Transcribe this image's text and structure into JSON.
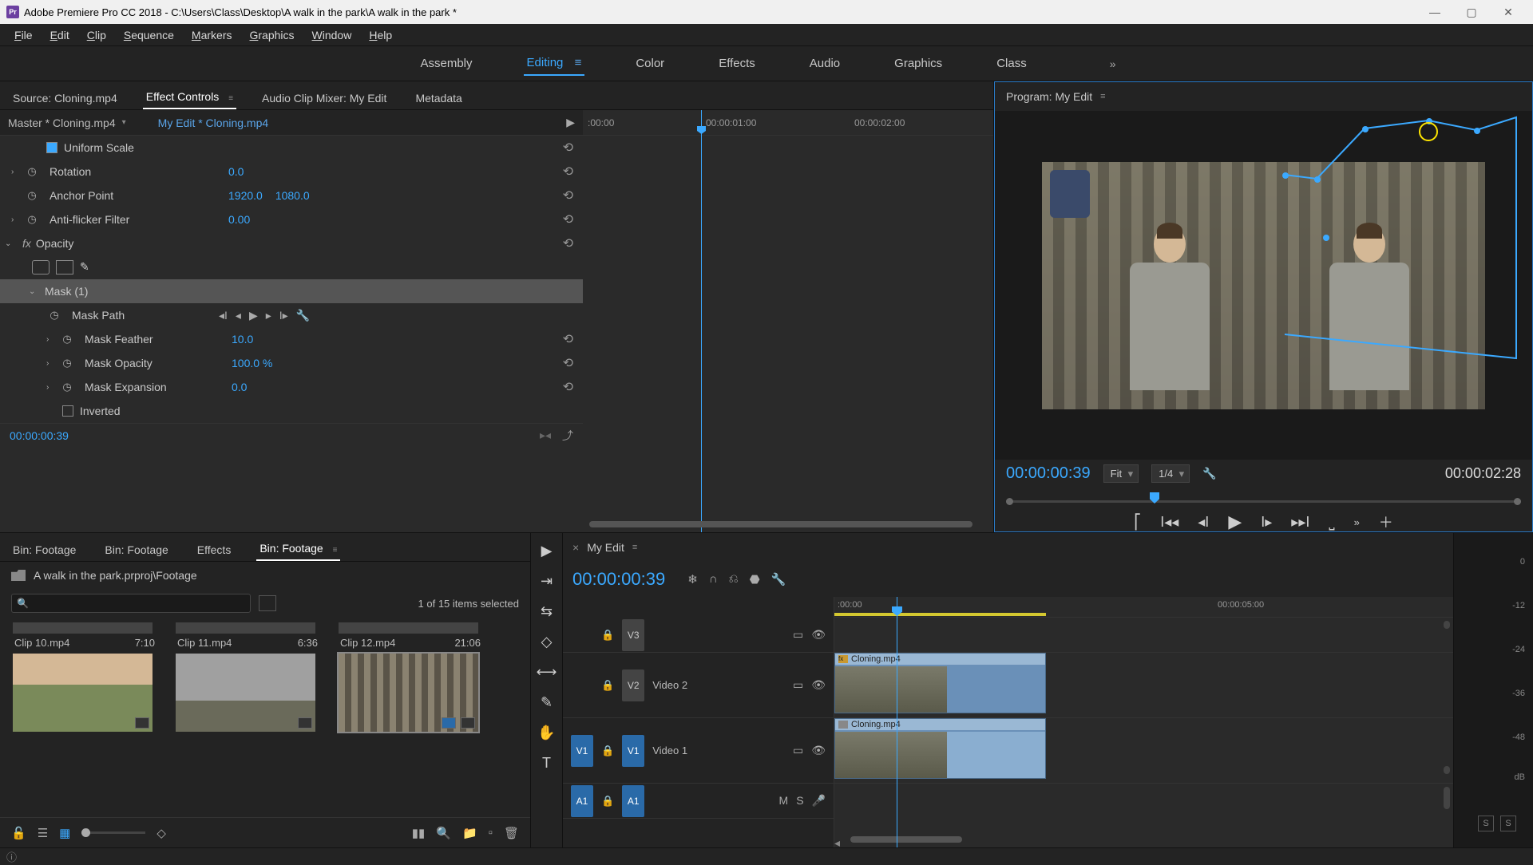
{
  "titlebar": {
    "app_abbrev": "Pr",
    "text": "Adobe Premiere Pro CC 2018 - C:\\Users\\Class\\Desktop\\A walk in the park\\A walk in the park *"
  },
  "menu": {
    "file": "File",
    "edit": "Edit",
    "clip": "Clip",
    "sequence": "Sequence",
    "markers": "Markers",
    "graphics": "Graphics",
    "window": "Window",
    "help": "Help"
  },
  "workspaces": {
    "assembly": "Assembly",
    "editing": "Editing",
    "color": "Color",
    "effects": "Effects",
    "audio": "Audio",
    "graphics": "Graphics",
    "class": "Class"
  },
  "source_tabs": {
    "source": "Source: Cloning.mp4",
    "effect_controls": "Effect Controls",
    "audio_mixer": "Audio Clip Mixer: My Edit",
    "metadata": "Metadata"
  },
  "effect_controls": {
    "master": "Master * Cloning.mp4",
    "sequence": "My Edit * Cloning.mp4",
    "uniform_scale": "Uniform Scale",
    "rotation": {
      "label": "Rotation",
      "value": "0.0"
    },
    "anchor": {
      "label": "Anchor Point",
      "x": "1920.0",
      "y": "1080.0"
    },
    "antiflicker": {
      "label": "Anti-flicker Filter",
      "value": "0.00"
    },
    "opacity": "Opacity",
    "mask": "Mask (1)",
    "mask_path": "Mask Path",
    "mask_feather": {
      "label": "Mask Feather",
      "value": "10.0"
    },
    "mask_opacity": {
      "label": "Mask Opacity",
      "value": "100.0 %"
    },
    "mask_expansion": {
      "label": "Mask Expansion",
      "value": "0.0"
    },
    "inverted": "Inverted",
    "time_00": ":00:00",
    "time_01": "00:00:01:00",
    "time_02": "00:00:02:00",
    "timecode": "00:00:00:39"
  },
  "program": {
    "title": "Program: My Edit",
    "timecode": "00:00:00:39",
    "fit": "Fit",
    "zoom": "1/4",
    "duration": "00:00:02:28"
  },
  "project": {
    "tabs": {
      "b1": "Bin: Footage",
      "b2": "Bin: Footage",
      "effects": "Effects",
      "b3": "Bin: Footage"
    },
    "path": "A walk in the park.prproj\\Footage",
    "count": "1 of 15 items selected",
    "clips": [
      {
        "name": "Clip 10.mp4",
        "dur": "7:10"
      },
      {
        "name": "Clip 11.mp4",
        "dur": "6:36"
      },
      {
        "name": "Clip 12.mp4",
        "dur": "21:06"
      }
    ]
  },
  "timeline": {
    "name": "My Edit",
    "timecode": "00:00:00:39",
    "ruler": {
      "t0": ":00:00",
      "t5": "00:00:05:00"
    },
    "tracks": {
      "v3": "V3",
      "v2": "V2",
      "v1": "V1",
      "a1": "A1",
      "video2": "Video 2",
      "video1": "Video 1",
      "m": "M",
      "s": "S"
    },
    "clip_name": "Cloning.mp4"
  },
  "meters": {
    "db0": "0",
    "db12": "-12",
    "db24": "-24",
    "db36": "-36",
    "db48": "-48",
    "dbl": "dB",
    "solo": "S"
  }
}
